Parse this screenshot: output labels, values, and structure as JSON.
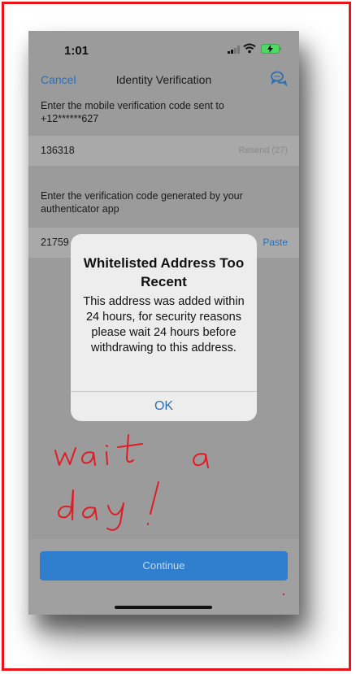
{
  "status_bar": {
    "time": "1:01"
  },
  "nav": {
    "cancel_label": "Cancel",
    "title": "Identity Verification"
  },
  "sms": {
    "prompt": "Enter the mobile verification code sent to +12******627",
    "code": "136318",
    "resend_label": "Resend (27)"
  },
  "authenticator": {
    "prompt": "Enter the verification code generated by your authenticator app",
    "code": "21759",
    "paste_label": "Paste"
  },
  "alert": {
    "title": "Whitelisted Address Too Recent",
    "message": "This address was added within 24 hours, for security reasons please wait 24 hours before withdrawing to this address.",
    "ok_label": "OK"
  },
  "annotation": {
    "text": "wait a day!",
    "color": "#e01b24"
  },
  "continue_label": "Continue",
  "colors": {
    "frame_border": "#e8141a",
    "accent": "#2d6fb4",
    "button": "#2f7fce"
  }
}
